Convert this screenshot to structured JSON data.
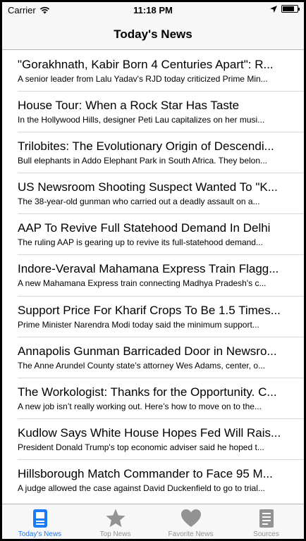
{
  "status": {
    "carrier": "Carrier",
    "time": "11:18 PM",
    "battery_level": 0.8
  },
  "nav": {
    "title": "Today's News"
  },
  "articles": [
    {
      "title": "\"Gorakhnath, Kabir Born 4 Centuries Apart\": R...",
      "desc": "A senior leader from Lalu Yadav's RJD today criticized Prime Min..."
    },
    {
      "title": "House Tour: When a Rock Star Has Taste",
      "desc": "In the Hollywood Hills, designer Peti Lau capitalizes on her musi..."
    },
    {
      "title": "Trilobites: The Evolutionary Origin of Descendi...",
      "desc": "Bull elephants in Addo Elephant Park in South Africa. They belon..."
    },
    {
      "title": "US Newsroom Shooting Suspect Wanted To \"K...",
      "desc": "The 38-year-old gunman who carried out a deadly assault on a..."
    },
    {
      "title": "AAP To Revive Full Statehood Demand In Delhi",
      "desc": "The ruling AAP is gearing up to revive its full-statehood demand..."
    },
    {
      "title": "Indore-Veraval Mahamana Express Train Flagg...",
      "desc": "A new Mahamana Express train connecting Madhya Pradesh's c..."
    },
    {
      "title": "Support Price For Kharif Crops To Be 1.5 Times...",
      "desc": "Prime Minister Narendra Modi today said the minimum support..."
    },
    {
      "title": "Annapolis Gunman Barricaded Door in Newsro...",
      "desc": "The Anne Arundel County state’s attorney Wes Adams, center, o..."
    },
    {
      "title": "The Workologist: Thanks for the Opportunity. C...",
      "desc": "A new job isn’t really working out. Here’s how to move on to the..."
    },
    {
      "title": "Kudlow Says White House Hopes Fed Will Rais...",
      "desc": "President Donald Trump's top economic adviser said he hoped t..."
    },
    {
      "title": "Hillsborough Match Commander to Face 95 M...",
      "desc": "A judge allowed the case against David Duckenfield to go to trial..."
    }
  ],
  "tabs": [
    {
      "label": "Today's News",
      "icon": "newspaper-icon",
      "active": true
    },
    {
      "label": "Top News",
      "icon": "star-icon",
      "active": false
    },
    {
      "label": "Favorite News",
      "icon": "heart-icon",
      "active": false
    },
    {
      "label": "Sources",
      "icon": "list-icon",
      "active": false
    }
  ],
  "colors": {
    "active": "#1a7cf5",
    "inactive": "#929292",
    "background": "#f7f7f7"
  }
}
